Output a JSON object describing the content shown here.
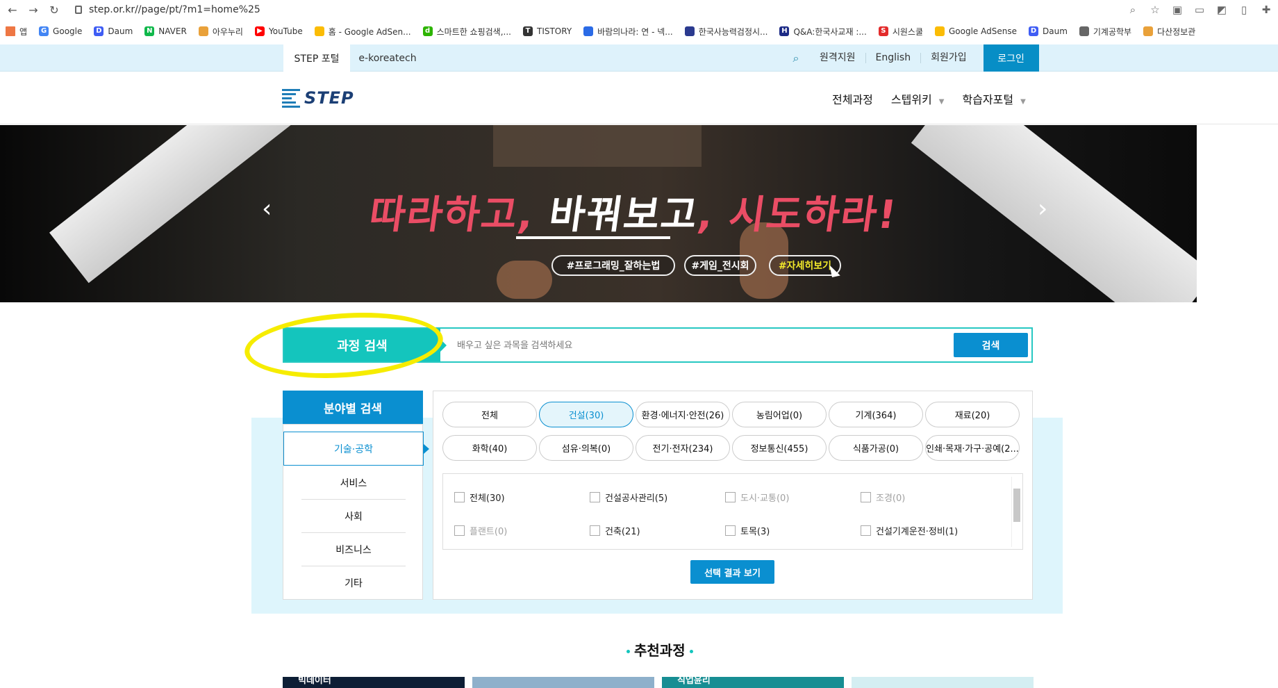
{
  "browser": {
    "url": "step.or.kr//page/pt/?m1=home%25",
    "bookmarks": [
      "앱",
      "Google",
      "Daum",
      "NAVER",
      "아우누리",
      "YouTube",
      "홈 - Google AdSen...",
      "스마트한 쇼핑검색,...",
      "TISTORY",
      "바람의나라: 연 - 넥...",
      "한국사능력검정시...",
      "Q&A:한국사교재 :...",
      "시원스쿨",
      "Google AdSense",
      "Daum",
      "기계공학부",
      "다산정보관"
    ]
  },
  "topbar": {
    "tabs": [
      "STEP 포털",
      "e-koreatech"
    ],
    "links": [
      "원격지원",
      "English",
      "회원가입"
    ],
    "login": "로그인"
  },
  "header": {
    "logo": "STEP",
    "nav": [
      "전체과정",
      "스텝위키",
      "학습자포털"
    ]
  },
  "banner": {
    "slogan_a": "따라하고, ",
    "slogan_b": "바꿔보고",
    "slogan_c": ", 시도하라!",
    "tags": [
      "#프로그래밍_잘하는법",
      "#게임_전시회",
      "#자세히보기"
    ]
  },
  "course_search": {
    "title": "과정 검색",
    "placeholder": "배우고 싶은 과목을 검색하세요",
    "button": "검색"
  },
  "field_search": {
    "title": "분야별 검색",
    "sidebar": [
      "기술·공학",
      "서비스",
      "사회",
      "비즈니스",
      "기타"
    ],
    "categories": [
      "전체",
      "건설(30)",
      "환경·에너지·안전(26)",
      "농림어업(0)",
      "기계(364)",
      "재료(20)",
      "화학(40)",
      "섬유·의복(0)",
      "전기·전자(234)",
      "정보통신(455)",
      "식품가공(0)",
      "인쇄·목재·가구·공예(2..."
    ],
    "subcategories": [
      "전체(30)",
      "건설공사관리(5)",
      "도시·교통(0)",
      "조경(0)",
      "플랜트(0)",
      "건축(21)",
      "토목(3)",
      "건설기계운전·정비(1)"
    ],
    "result_button": "선택 결과 보기"
  },
  "recommend": {
    "title": "추천과정",
    "cards": [
      "빅데이터",
      "",
      "직업윤리",
      ""
    ]
  }
}
